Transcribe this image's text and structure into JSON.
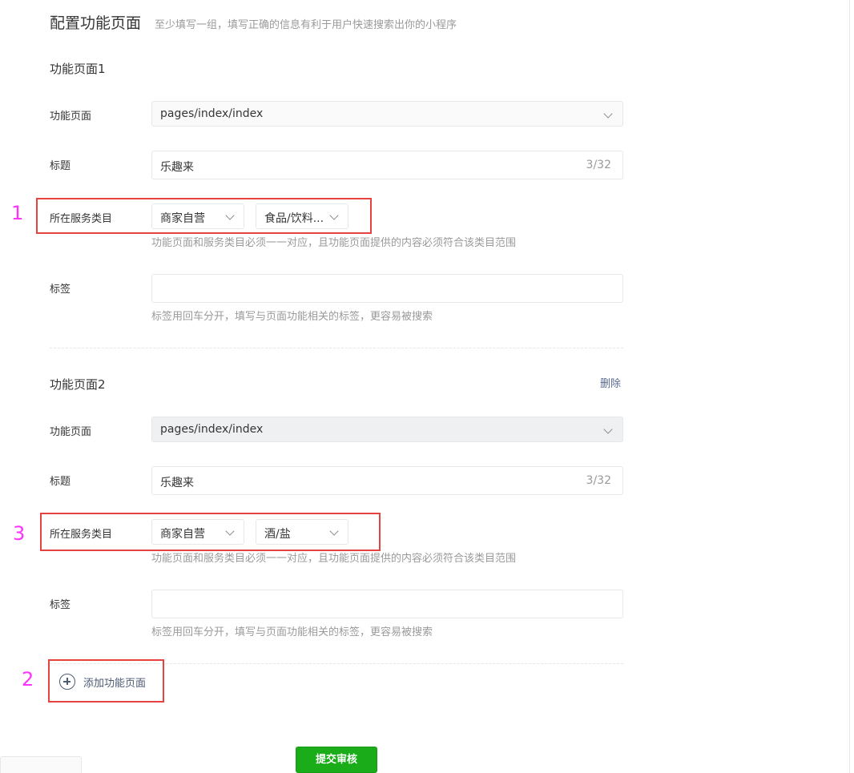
{
  "header": {
    "title": "配置功能页面",
    "subtitle": "至少填写一组，填写正确的信息有利于用户快速搜索出你的小程序"
  },
  "labels": {
    "page": "功能页面",
    "title": "标题",
    "category": "所在服务类目",
    "tags": "标签"
  },
  "hints": {
    "category": "功能页面和服务类目必须一一对应，且功能页面提供的内容必须符合该类目范围",
    "tags": "标签用回车分开，填写与页面功能相关的标签，更容易被搜索"
  },
  "pages": [
    {
      "section_title": "功能页面1",
      "page_value": "pages/index/index",
      "title_value": "乐趣来",
      "title_counter": "3/32",
      "category_1": "商家自营",
      "category_2": "食品/饮料...",
      "tags_value": ""
    },
    {
      "section_title": "功能页面2",
      "delete_label": "删除",
      "page_value": "pages/index/index",
      "title_value": "乐趣来",
      "title_counter": "3/32",
      "category_1": "商家自营",
      "category_2": "酒/盐",
      "tags_value": ""
    }
  ],
  "add_page_label": "添加功能页面",
  "submit_label": "提交审核",
  "annotations": {
    "one": "1",
    "two": "2",
    "three": "3"
  },
  "colors": {
    "annotation_box": "#e64340",
    "annotation_number": "#ff31ff",
    "submit_bg": "#1aad19",
    "link": "#576b95"
  },
  "icons": {
    "add": "plus-circle-icon",
    "dropdown": "chevron-down-icon"
  }
}
